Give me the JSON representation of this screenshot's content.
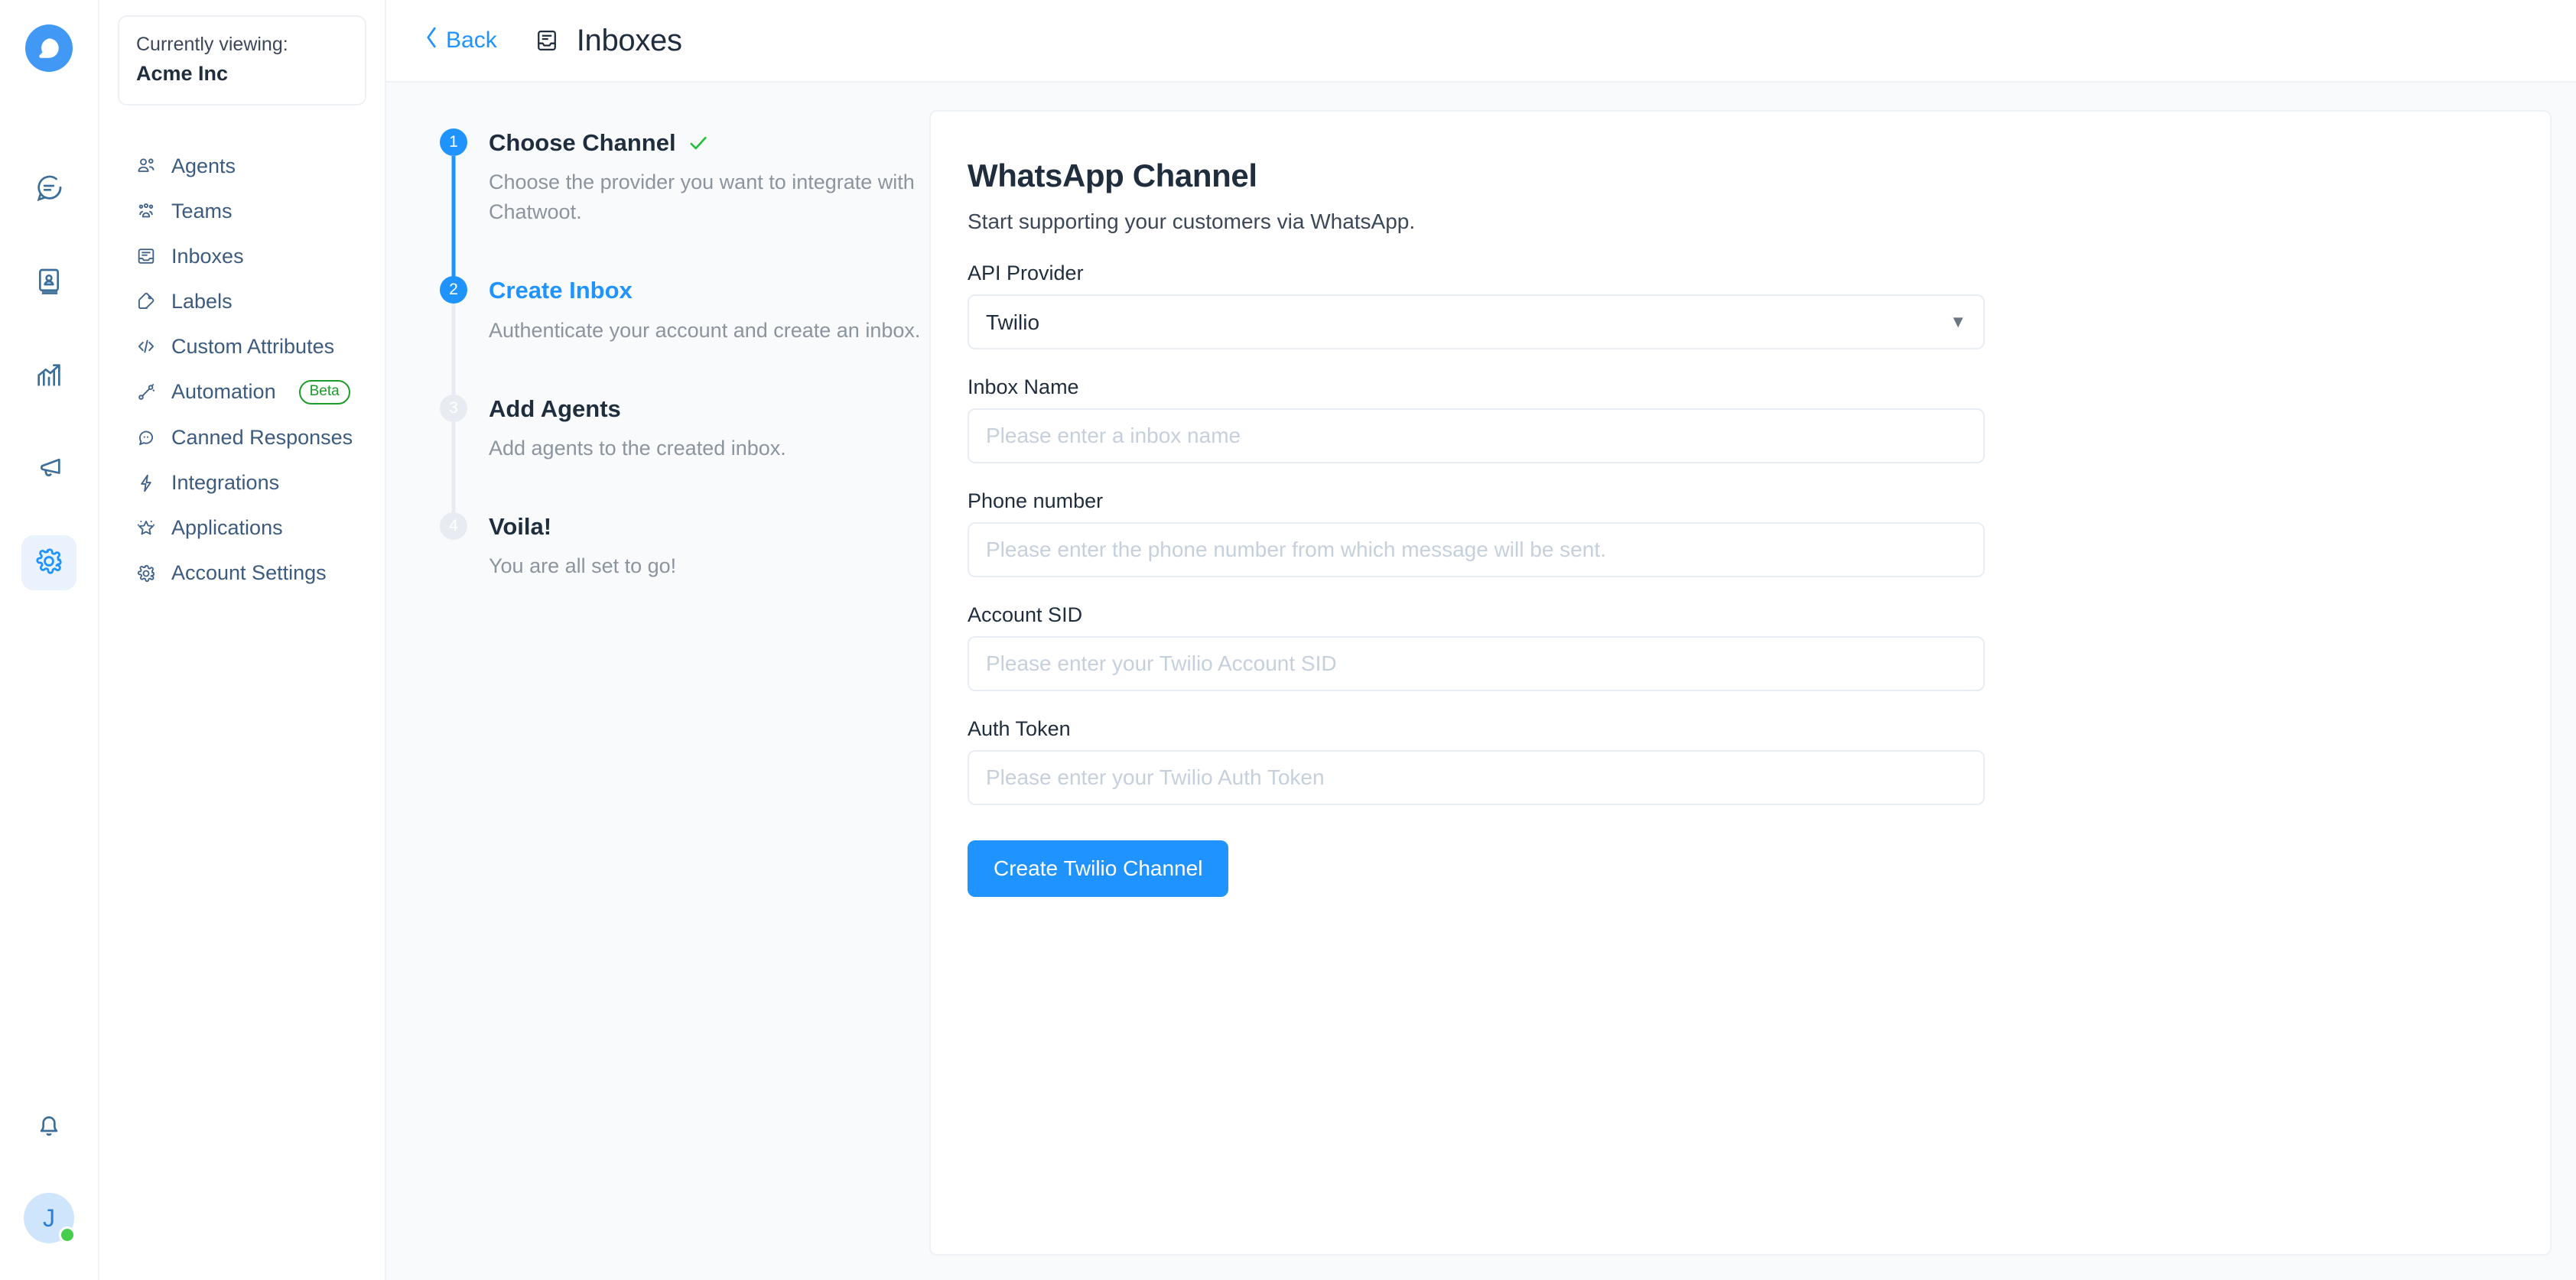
{
  "rail": {
    "brand_icon": "chatwoot-logo-icon",
    "items": [
      {
        "name": "conversations",
        "icon": "chat-bubble-icon",
        "active": false
      },
      {
        "name": "contacts",
        "icon": "contact-book-icon",
        "active": false
      },
      {
        "name": "reports",
        "icon": "chart-trending-icon",
        "active": false
      },
      {
        "name": "campaigns",
        "icon": "megaphone-icon",
        "active": false
      },
      {
        "name": "settings",
        "icon": "gear-icon",
        "active": true
      }
    ],
    "notifications_icon": "bell-icon",
    "avatar_initial": "J",
    "presence": "online"
  },
  "sidebar": {
    "account_switcher": {
      "label": "Currently viewing:",
      "account_name": "Acme Inc"
    },
    "items": [
      {
        "label": "Agents",
        "icon": "users-icon",
        "badge": ""
      },
      {
        "label": "Teams",
        "icon": "team-icon",
        "badge": ""
      },
      {
        "label": "Inboxes",
        "icon": "inbox-icon",
        "badge": ""
      },
      {
        "label": "Labels",
        "icon": "tag-icon",
        "badge": ""
      },
      {
        "label": "Custom Attributes",
        "icon": "code-icon",
        "badge": ""
      },
      {
        "label": "Automation",
        "icon": "flow-icon",
        "badge": "Beta"
      },
      {
        "label": "Canned Responses",
        "icon": "chat-dots-icon",
        "badge": ""
      },
      {
        "label": "Integrations",
        "icon": "bolt-icon",
        "badge": ""
      },
      {
        "label": "Applications",
        "icon": "star-burst-icon",
        "badge": ""
      },
      {
        "label": "Account Settings",
        "icon": "gear-icon",
        "badge": ""
      }
    ]
  },
  "topbar": {
    "back_label": "Back",
    "back_icon": "chevron-left-icon",
    "title_icon": "inbox-icon",
    "title": "Inboxes"
  },
  "wizard": {
    "steps": [
      {
        "number": "1",
        "title": "Choose Channel",
        "description": "Choose the provider you want to integrate with Chatwoot.",
        "state": "completed",
        "check_icon": "check-icon"
      },
      {
        "number": "2",
        "title": "Create Inbox",
        "description": "Authenticate your account and create an inbox.",
        "state": "current",
        "check_icon": ""
      },
      {
        "number": "3",
        "title": "Add Agents",
        "description": "Add agents to the created inbox.",
        "state": "inactive",
        "check_icon": ""
      },
      {
        "number": "4",
        "title": "Voila!",
        "description": "You are all set to go!",
        "state": "inactive",
        "check_icon": ""
      }
    ]
  },
  "form": {
    "title": "WhatsApp Channel",
    "subtitle": "Start supporting your customers via WhatsApp.",
    "api_provider": {
      "label": "API Provider",
      "value": "Twilio",
      "options": [
        "Twilio"
      ],
      "caret_icon": "chevron-down-icon"
    },
    "inbox_name": {
      "label": "Inbox Name",
      "value": "",
      "placeholder": "Please enter a inbox name"
    },
    "phone_number": {
      "label": "Phone number",
      "value": "",
      "placeholder": "Please enter the phone number from which message will be sent."
    },
    "account_sid": {
      "label": "Account SID",
      "value": "",
      "placeholder": "Please enter your Twilio Account SID"
    },
    "auth_token": {
      "label": "Auth Token",
      "value": "",
      "placeholder": "Please enter your Twilio Auth Token"
    },
    "submit_label": "Create Twilio Channel"
  },
  "colors": {
    "accent": "#1f93ff",
    "success": "#22c03a",
    "beta_badge": "#1c9c2a",
    "text_primary": "#1f2d3d",
    "text_muted": "#8c949e"
  }
}
